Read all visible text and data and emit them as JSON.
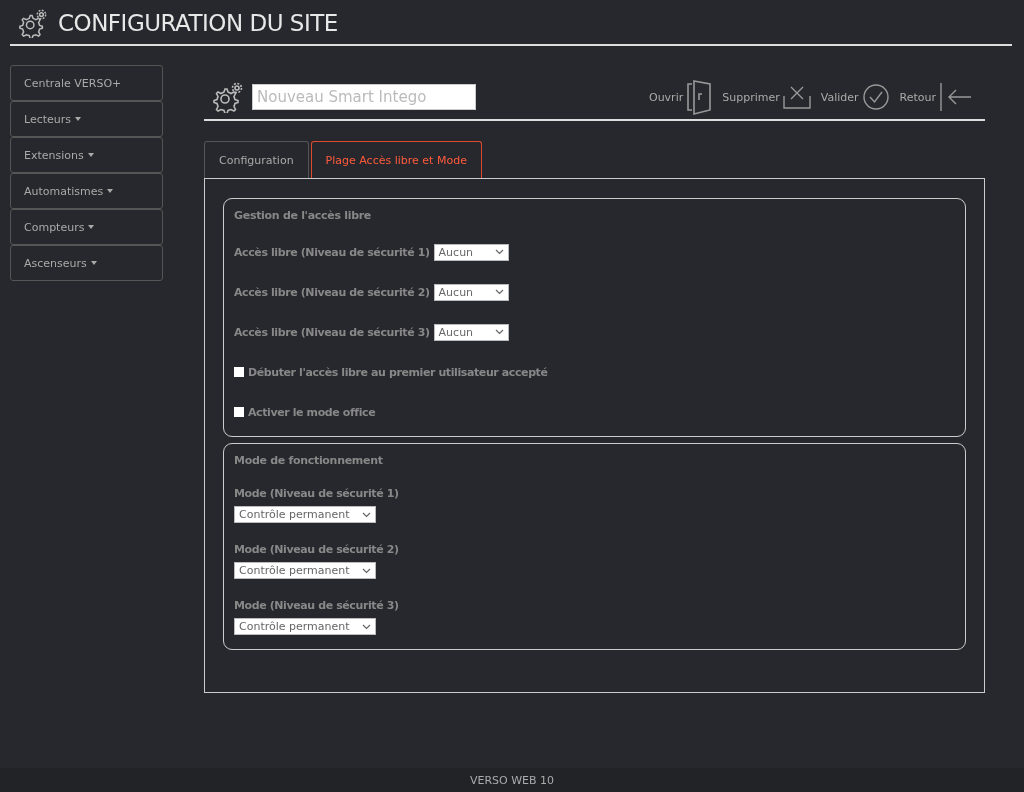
{
  "header": {
    "title": "CONFIGURATION DU SITE"
  },
  "sidebar": {
    "items": [
      {
        "label": "Centrale VERSO+",
        "has_menu": false
      },
      {
        "label": "Lecteurs",
        "has_menu": true
      },
      {
        "label": "Extensions",
        "has_menu": true
      },
      {
        "label": "Automatismes",
        "has_menu": true
      },
      {
        "label": "Compteurs",
        "has_menu": true
      },
      {
        "label": "Ascenseurs",
        "has_menu": true
      }
    ]
  },
  "toolbar": {
    "name_field": {
      "placeholder": "Nouveau Smart Intego"
    },
    "actions": [
      {
        "kind": "open",
        "label": "Ouvrir"
      },
      {
        "kind": "delete",
        "label": "Supprimer"
      },
      {
        "kind": "validate",
        "label": "Valider"
      },
      {
        "kind": "back",
        "label": "Retour"
      }
    ]
  },
  "tabs": [
    {
      "label": "Configuration",
      "selected": false
    },
    {
      "label": "Plage Accès libre et Mode",
      "selected": true
    }
  ],
  "free_access": {
    "title": "Gestion de l'accès libre",
    "fields": [
      {
        "kind": "select",
        "label": "Accès libre (Niveau de sécurité 1)",
        "value": "Aucun"
      },
      {
        "kind": "select",
        "label": "Accès libre (Niveau de sécurité 2)",
        "value": "Aucun"
      },
      {
        "kind": "select",
        "label": "Accès libre (Niveau de sécurité 3)",
        "value": "Aucun"
      },
      {
        "kind": "checkbox",
        "label": "Débuter l'accès libre au premier utilisateur accepté",
        "checked": false
      },
      {
        "kind": "checkbox",
        "label": "Activer le mode office",
        "checked": false
      }
    ]
  },
  "operating_mode": {
    "title": "Mode de fonctionnement",
    "fields": [
      {
        "label": "Mode (Niveau de sécurité 1)",
        "value": "Contrôle permanent"
      },
      {
        "label": "Mode (Niveau de sécurité 2)",
        "value": "Contrôle permanent"
      },
      {
        "label": "Mode (Niveau de sécurité 3)",
        "value": "Contrôle permanent"
      }
    ]
  },
  "footer": {
    "text": "VERSO WEB 10"
  }
}
